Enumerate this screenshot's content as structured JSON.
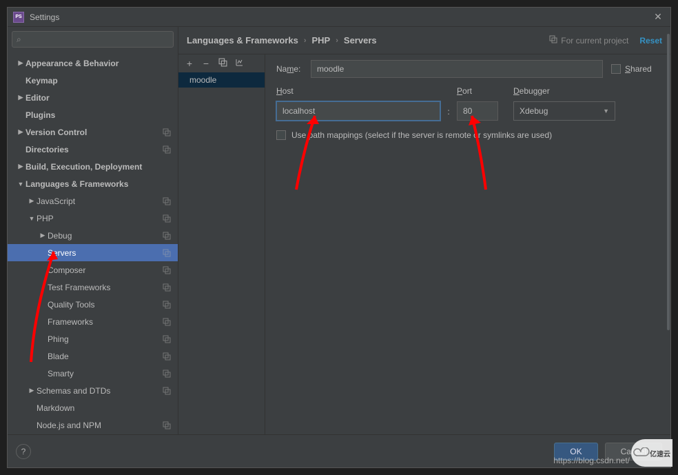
{
  "window": {
    "title": "Settings",
    "app_icon_text": "PS"
  },
  "search": {
    "placeholder": ""
  },
  "tree": [
    {
      "label": "Appearance & Behavior",
      "indent": 0,
      "arrow": "collapsed",
      "bold": true,
      "stack": false
    },
    {
      "label": "Keymap",
      "indent": 0,
      "arrow": "none",
      "bold": true,
      "stack": false
    },
    {
      "label": "Editor",
      "indent": 0,
      "arrow": "collapsed",
      "bold": true,
      "stack": false
    },
    {
      "label": "Plugins",
      "indent": 0,
      "arrow": "none",
      "bold": true,
      "stack": false
    },
    {
      "label": "Version Control",
      "indent": 0,
      "arrow": "collapsed",
      "bold": true,
      "stack": true
    },
    {
      "label": "Directories",
      "indent": 0,
      "arrow": "none",
      "bold": true,
      "stack": true
    },
    {
      "label": "Build, Execution, Deployment",
      "indent": 0,
      "arrow": "collapsed",
      "bold": true,
      "stack": false
    },
    {
      "label": "Languages & Frameworks",
      "indent": 0,
      "arrow": "expanded",
      "bold": true,
      "stack": false
    },
    {
      "label": "JavaScript",
      "indent": 1,
      "arrow": "collapsed",
      "bold": false,
      "stack": true
    },
    {
      "label": "PHP",
      "indent": 1,
      "arrow": "expanded",
      "bold": false,
      "stack": true
    },
    {
      "label": "Debug",
      "indent": 2,
      "arrow": "collapsed",
      "bold": false,
      "stack": true
    },
    {
      "label": "Servers",
      "indent": 2,
      "arrow": "none",
      "bold": false,
      "stack": true,
      "selected": true
    },
    {
      "label": "Composer",
      "indent": 2,
      "arrow": "none",
      "bold": false,
      "stack": true
    },
    {
      "label": "Test Frameworks",
      "indent": 2,
      "arrow": "none",
      "bold": false,
      "stack": true
    },
    {
      "label": "Quality Tools",
      "indent": 2,
      "arrow": "none",
      "bold": false,
      "stack": true
    },
    {
      "label": "Frameworks",
      "indent": 2,
      "arrow": "none",
      "bold": false,
      "stack": true
    },
    {
      "label": "Phing",
      "indent": 2,
      "arrow": "none",
      "bold": false,
      "stack": true
    },
    {
      "label": "Blade",
      "indent": 2,
      "arrow": "none",
      "bold": false,
      "stack": true
    },
    {
      "label": "Smarty",
      "indent": 2,
      "arrow": "none",
      "bold": false,
      "stack": true
    },
    {
      "label": "Schemas and DTDs",
      "indent": 1,
      "arrow": "collapsed",
      "bold": false,
      "stack": true
    },
    {
      "label": "Markdown",
      "indent": 1,
      "arrow": "none",
      "bold": false,
      "stack": false
    },
    {
      "label": "Node.js and NPM",
      "indent": 1,
      "arrow": "none",
      "bold": false,
      "stack": true
    }
  ],
  "breadcrumb": [
    "Languages & Frameworks",
    "PHP",
    "Servers"
  ],
  "header": {
    "project_hint": "For current project",
    "reset": "Reset"
  },
  "servers": {
    "items": [
      "moodle"
    ]
  },
  "form": {
    "name_label": "Name:",
    "name_value": "moodle",
    "shared_label": "Shared",
    "host_label": "Host",
    "host_value": "localhost",
    "port_label": "Port",
    "port_value": "80",
    "debugger_label": "Debugger",
    "debugger_value": "Xdebug",
    "mapping_label": "Use path mappings (select if the server is remote or symlinks are used)"
  },
  "footer": {
    "ok": "OK",
    "cancel": "Cancel",
    "help": "?"
  },
  "watermark": "https://blog.csdn.net/",
  "logo_wm": "亿速云"
}
